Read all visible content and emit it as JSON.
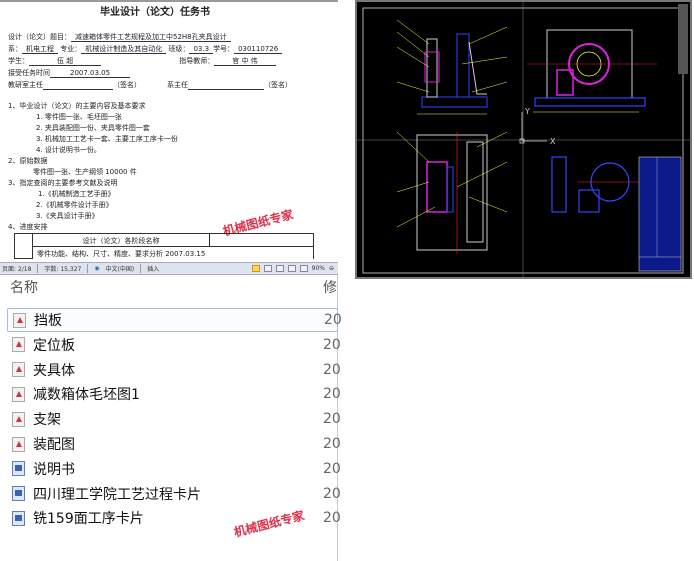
{
  "document": {
    "title": "毕业设计（论文）任务书",
    "topic_label": "设计（论文）题目：",
    "topic": "减速箱体零件工艺规程及加工中52H8孔夹具设计",
    "dept_label": "系：",
    "dept": "机电工程",
    "major_label": "专业：",
    "major": "机械设计制造及其自动化",
    "class_label": "班级：",
    "class": "03.3",
    "id_label": "学号：",
    "id": "030110726",
    "student_label": "学生：",
    "student": "伍 超",
    "advisor_label": "指导教师：",
    "advisor": "官 中 伟",
    "date_label": "接受任务时间",
    "date": "2007.03.05",
    "room_head_label": "教研室主任",
    "sign1": "（签名）",
    "dept_head_label": "系主任",
    "sign2": "（签名）",
    "s1": "1、毕业设计（论文）的主要内容及基本要求",
    "s1_items": [
      "1. 零件图一张、毛坯图一张",
      "2. 夹具装配图一份、夹具零件图一套",
      "3. 机械加工工艺卡一套、主要工序工序卡一份",
      "4. 设计说明书一份。"
    ],
    "s2": "2、原始数据",
    "s2_text": "零件图一张、生产纲领 10000 件",
    "s3": "3、指定查阅的主要参考文献及说明",
    "s3_items": [
      "1.《机械制造工艺手册》",
      "2.《机械零件设计手册》",
      "3.《夹具设计手册》"
    ],
    "s4": "4、进度安排",
    "table_header": "设计（论文）各阶段名称",
    "table_row": "零件功能、结构、尺寸、精度、要求分析 2007.03.15"
  },
  "statusbar": {
    "page": "页面: 2/18",
    "words": "字数: 15,327",
    "lang": "中文(中国)",
    "mode": "插入",
    "zoom": "90%"
  },
  "files": {
    "col_name": "名称",
    "col_modified": "修",
    "items": [
      {
        "name": "挡板",
        "type": "dwg",
        "date": "20"
      },
      {
        "name": "定位板",
        "type": "dwg",
        "date": "20"
      },
      {
        "name": "夹具体",
        "type": "dwg",
        "date": "20"
      },
      {
        "name": "减数箱体毛坯图1",
        "type": "dwg",
        "date": "20"
      },
      {
        "name": "支架",
        "type": "dwg",
        "date": "20"
      },
      {
        "name": "装配图",
        "type": "dwg",
        "date": "20"
      },
      {
        "name": "说明书",
        "type": "docx",
        "date": "20"
      },
      {
        "name": "四川理工学院工艺过程卡片",
        "type": "docx",
        "date": "20"
      },
      {
        "name": "铣159面工序卡片",
        "type": "docx",
        "date": "20"
      }
    ]
  },
  "watermark": "机械图纸专家",
  "cad": {
    "axis_y": "Y",
    "axis_x": "X",
    "colors": {
      "background": "#000000",
      "outline": "#ffffff",
      "part": "#3344ff",
      "highlight": "#dd22dd",
      "dimension": "#ffff33",
      "center": "#ff2222"
    }
  }
}
